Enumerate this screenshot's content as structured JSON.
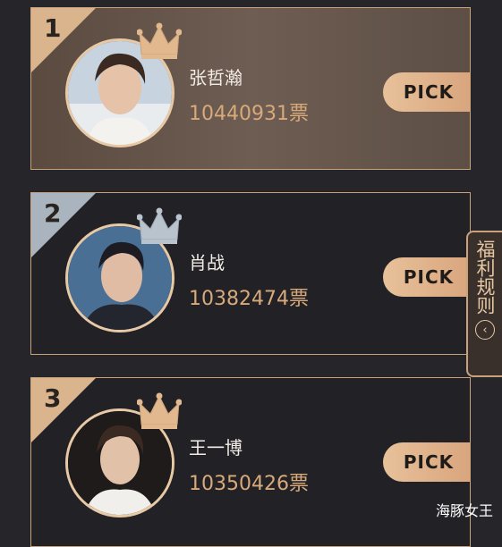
{
  "ranking": [
    {
      "rank": "1",
      "name": "张哲瀚",
      "votes": "10440931票",
      "pick_label": "PICK",
      "crown": "gold",
      "corner": "gold"
    },
    {
      "rank": "2",
      "name": "肖战",
      "votes": "10382474票",
      "pick_label": "PICK",
      "crown": "silver",
      "corner": "silver"
    },
    {
      "rank": "3",
      "name": "王一博",
      "votes": "10350426票",
      "pick_label": "PICK",
      "crown": "gold",
      "corner": "gold"
    }
  ],
  "side_tab": {
    "label": "福利规则",
    "icon": "chevron-left-circle-icon"
  },
  "watermark": "海豚女王",
  "colors": {
    "gold": "#d9b48d",
    "silver": "#a9b4bf",
    "accent_text": "#d8aa7b",
    "background": "#25252a"
  }
}
